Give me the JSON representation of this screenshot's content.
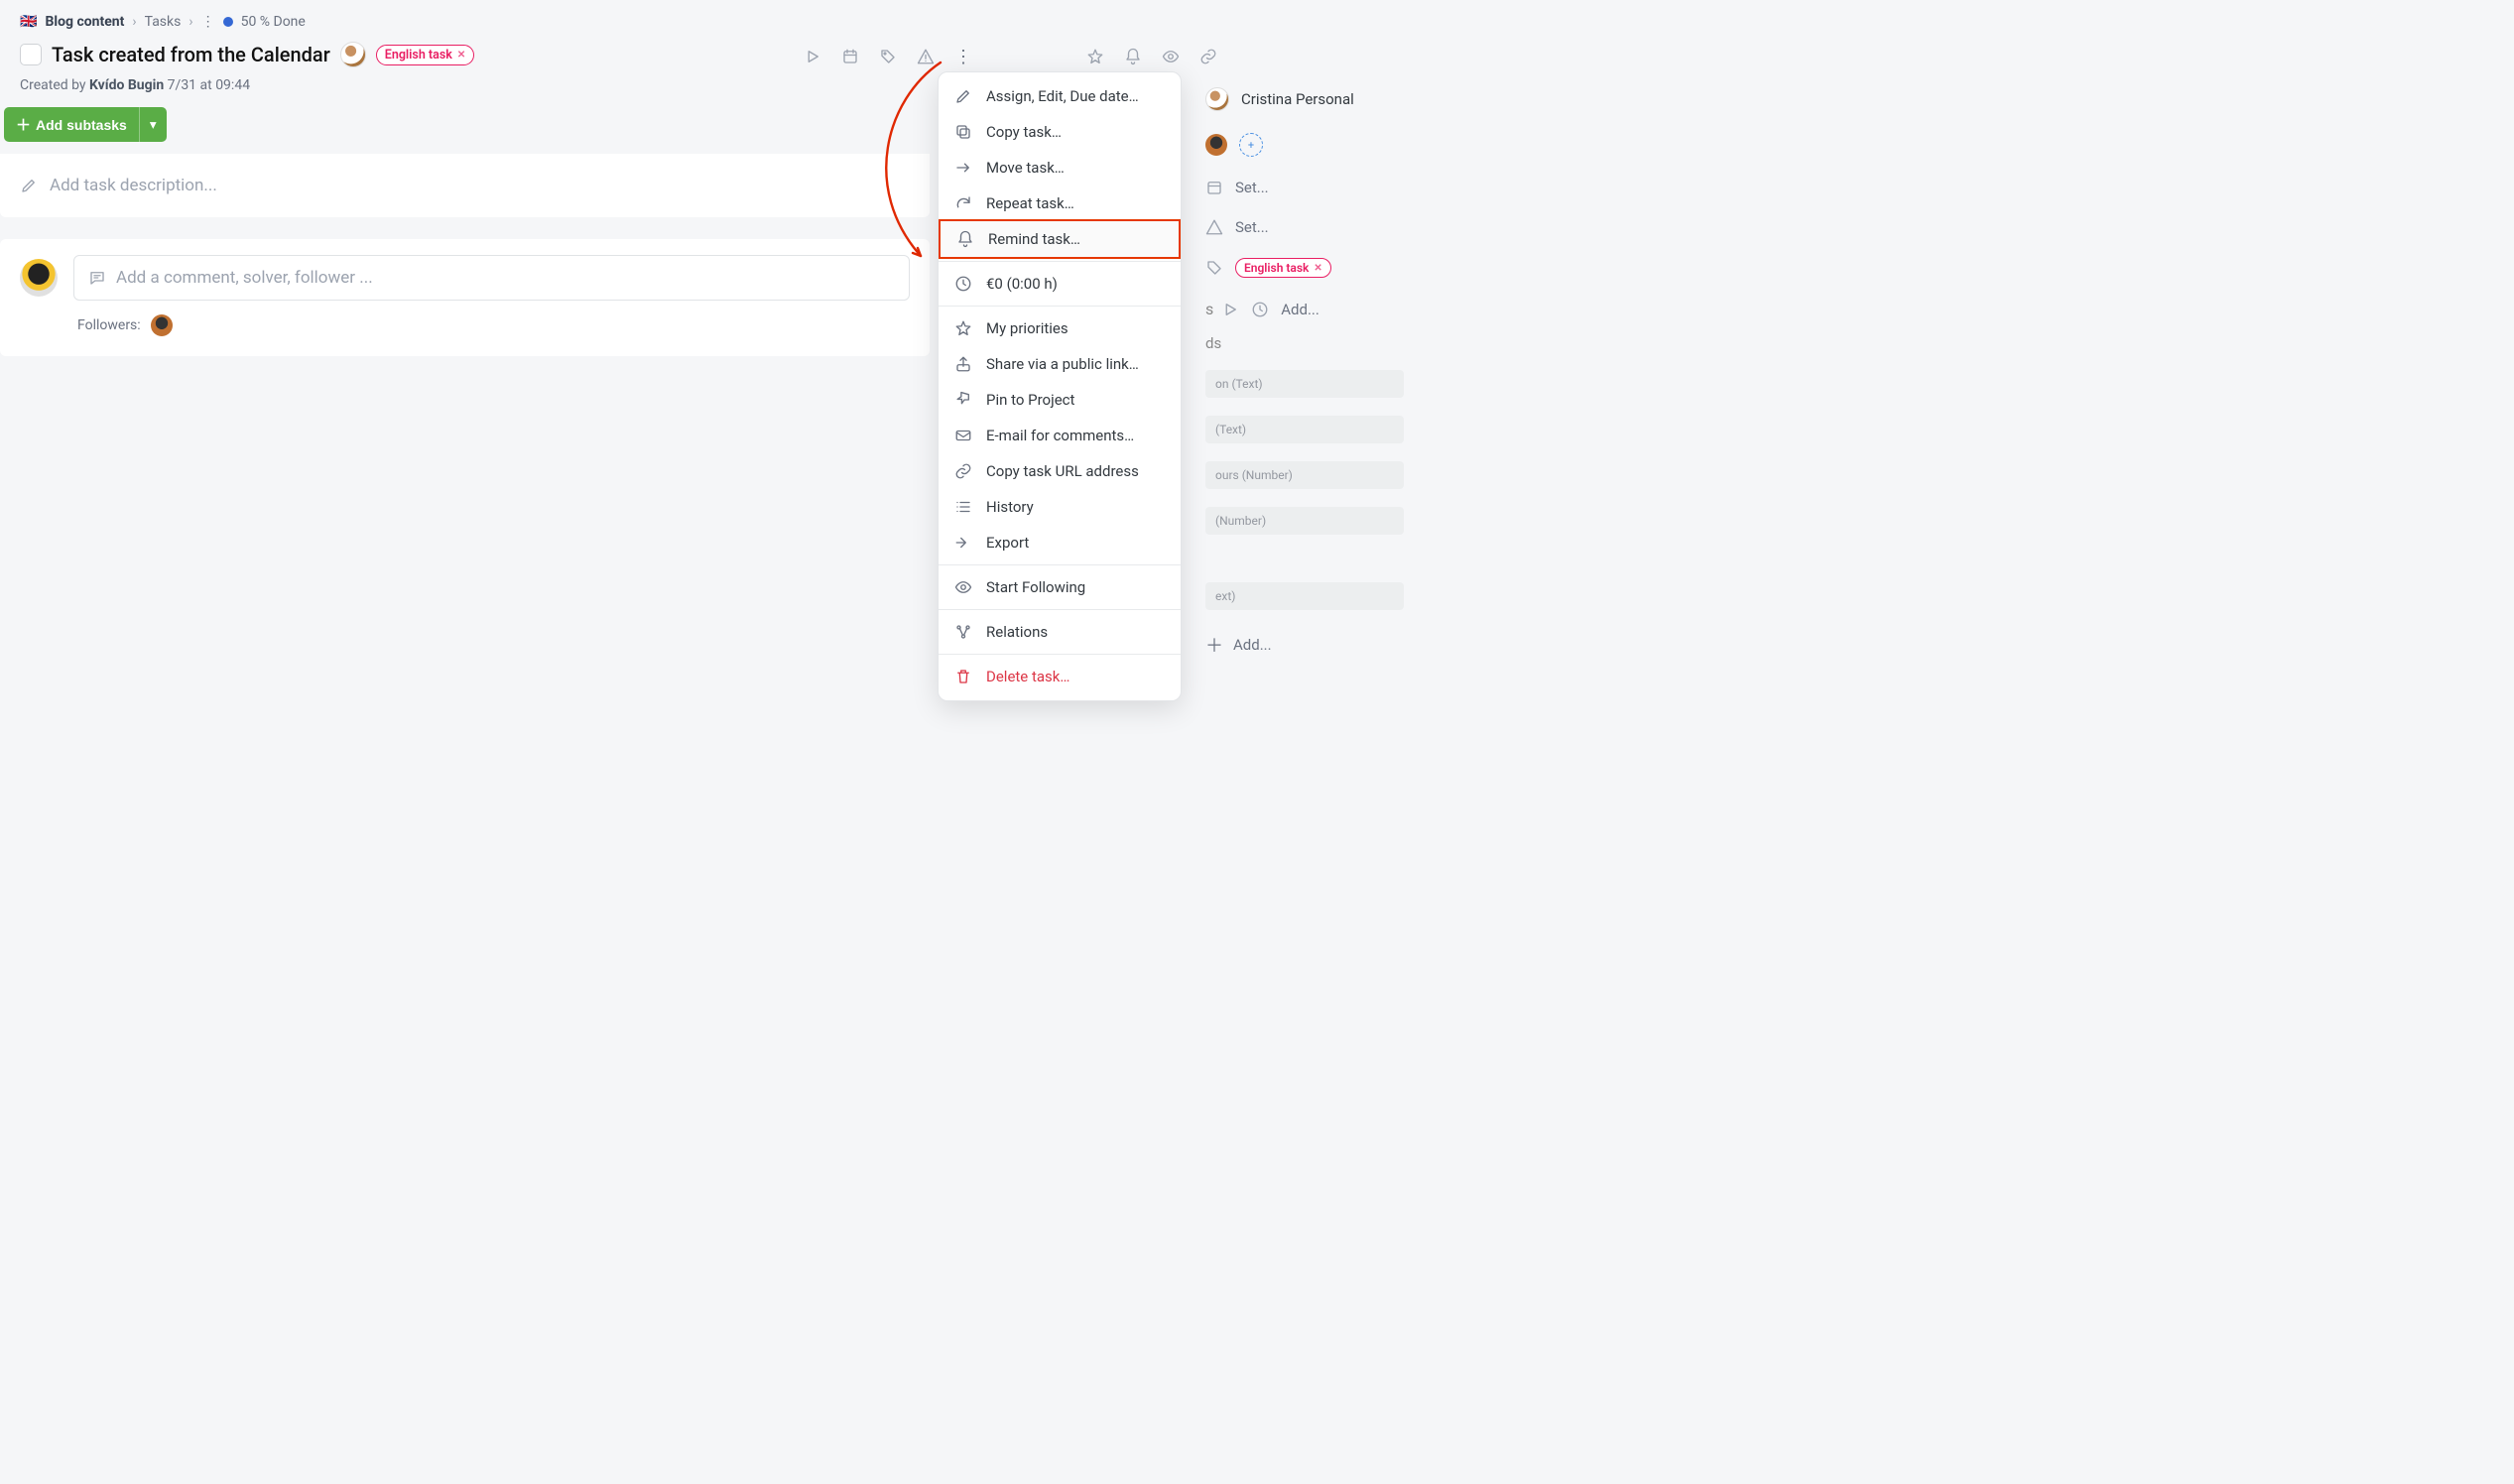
{
  "breadcrumb": {
    "flag": "🇬🇧",
    "project": "Blog content",
    "section": "Tasks",
    "status_dot": "#3568d4",
    "status": "50 % Done"
  },
  "title": "Task created from the Calendar",
  "tag": {
    "label": "English task"
  },
  "meta": {
    "prefix": "Created by",
    "author": "Kvído Bugin",
    "ts": "7/31 at 09:44"
  },
  "addsub": {
    "label": "Add subtasks"
  },
  "placeholders": {
    "desc": "Add task description...",
    "comment": "Add a comment, solver, follower ..."
  },
  "followers_label": "Followers:",
  "menu": {
    "assign": "Assign, Edit, Due date…",
    "copy": "Copy task…",
    "move": "Move task…",
    "repeat": "Repeat task…",
    "remind": "Remind task…",
    "cost": "€0 (0:00 h)",
    "prio": "My priorities",
    "share": "Share via a public link…",
    "pin": "Pin to Project",
    "email": "E-mail for comments…",
    "url": "Copy task URL address",
    "history": "History",
    "export": "Export",
    "follow": "Start Following",
    "rel": "Relations",
    "delete": "Delete task…"
  },
  "sidebar": {
    "assignee": "Cristina Personal",
    "set": "Set...",
    "tag": "English task",
    "add": "Add...",
    "fields": {
      "f1": "on  (Text)",
      "f2": "(Text)",
      "f3": "ours  (Number)",
      "f4": "(Number)",
      "f5": "ext)"
    },
    "addfield": "Add..."
  }
}
